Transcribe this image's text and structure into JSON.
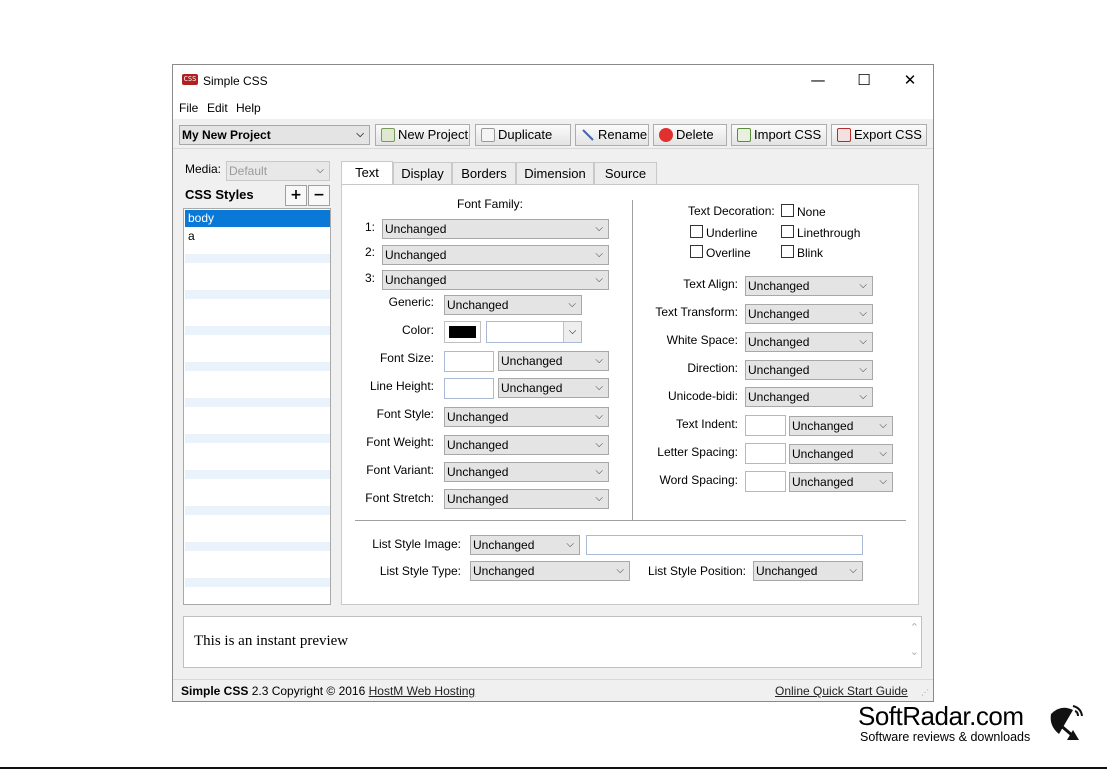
{
  "window": {
    "title": "Simple CSS",
    "controls": {
      "minimize": "—",
      "maximize": "☐",
      "close": "✕"
    }
  },
  "menu": [
    "File",
    "Edit",
    "Help"
  ],
  "toolbar": {
    "project": "My New Project",
    "buttons": [
      "New Project",
      "Duplicate",
      "Rename",
      "Delete",
      "Import CSS",
      "Export CSS"
    ]
  },
  "sidebar": {
    "media_label": "Media:",
    "media_value": "Default",
    "styles_heading": "CSS Styles",
    "add": "+",
    "remove": "−",
    "items": [
      "body",
      "a"
    ]
  },
  "tabs": [
    "Text",
    "Display",
    "Borders",
    "Dimension",
    "Source"
  ],
  "text_tab": {
    "font_family_heading": "Font Family:",
    "font_family": [
      {
        "num": "1:",
        "value": "Unchanged"
      },
      {
        "num": "2:",
        "value": "Unchanged"
      },
      {
        "num": "3:",
        "value": "Unchanged"
      }
    ],
    "generic": {
      "label": "Generic:",
      "value": "Unchanged"
    },
    "color": {
      "label": "Color:",
      "swatch": "#000000"
    },
    "font_size": {
      "label": "Font Size:",
      "value": "Unchanged"
    },
    "line_height": {
      "label": "Line Height:",
      "value": "Unchanged"
    },
    "font_style": {
      "label": "Font Style:",
      "value": "Unchanged"
    },
    "font_weight": {
      "label": "Font Weight:",
      "value": "Unchanged"
    },
    "font_variant": {
      "label": "Font Variant:",
      "value": "Unchanged"
    },
    "font_stretch": {
      "label": "Font Stretch:",
      "value": "Unchanged"
    },
    "decoration": {
      "label": "Text Decoration:",
      "none": "None",
      "underline": "Underline",
      "linethrough": "Linethrough",
      "overline": "Overline",
      "blink": "Blink"
    },
    "text_align": {
      "label": "Text Align:",
      "value": "Unchanged"
    },
    "text_transform": {
      "label": "Text Transform:",
      "value": "Unchanged"
    },
    "white_space": {
      "label": "White Space:",
      "value": "Unchanged"
    },
    "direction": {
      "label": "Direction:",
      "value": "Unchanged"
    },
    "unicode_bidi": {
      "label": "Unicode-bidi:",
      "value": "Unchanged"
    },
    "text_indent": {
      "label": "Text Indent:",
      "value": "Unchanged"
    },
    "letter_spacing": {
      "label": "Letter Spacing:",
      "value": "Unchanged"
    },
    "word_spacing": {
      "label": "Word Spacing:",
      "value": "Unchanged"
    },
    "list_style_image": {
      "label": "List Style Image:",
      "value": "Unchanged"
    },
    "list_style_type": {
      "label": "List Style Type:",
      "value": "Unchanged"
    },
    "list_style_position": {
      "label": "List Style Position:",
      "value": "Unchanged"
    }
  },
  "preview": "This is an instant preview",
  "status": {
    "app": "Simple CSS",
    "version": "2.3 Copyright © 2016",
    "link": "HostM Web Hosting",
    "guide": "Online Quick Start Guide"
  },
  "watermark": {
    "brand": "SoftRadar.com",
    "tagline": "Software reviews & downloads"
  }
}
